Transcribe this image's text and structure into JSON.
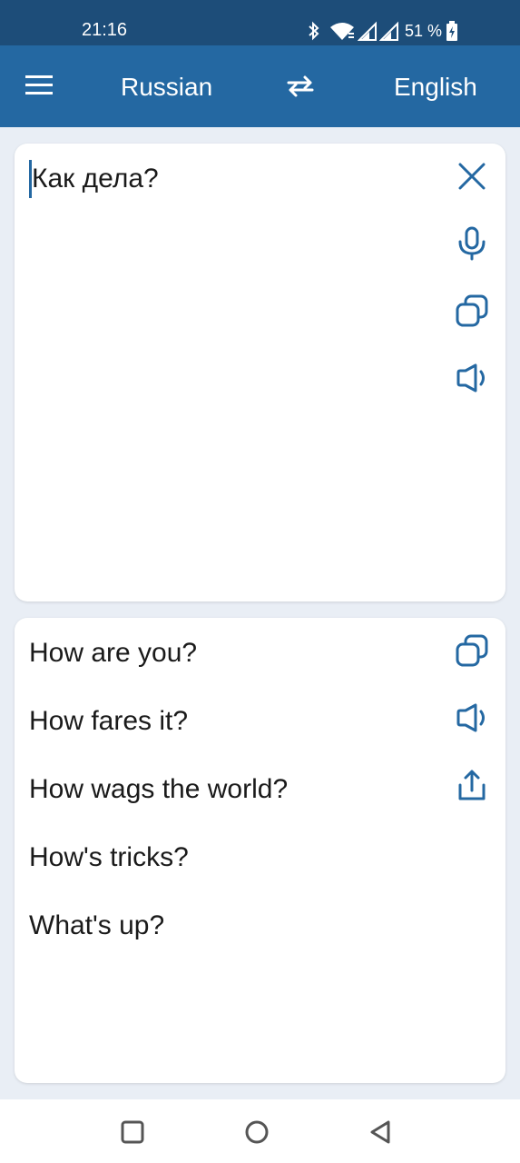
{
  "status": {
    "time": "21:16",
    "battery": "51 %",
    "icons": [
      "bluetooth-icon",
      "wifi-icon",
      "signal-icon",
      "signal-icon",
      "battery-charging-icon"
    ]
  },
  "toolbar": {
    "source_language": "Russian",
    "target_language": "English",
    "menu_icon": "menu-icon",
    "swap_icon": "swap-arrows-icon"
  },
  "input": {
    "text": "Как дела?",
    "actions": [
      "close-icon",
      "microphone-icon",
      "copy-icon",
      "speaker-icon"
    ]
  },
  "output": {
    "results": [
      "How are you?",
      "How fares it?",
      "How wags the world?",
      "How's tricks?",
      "What's up?"
    ],
    "actions": [
      "copy-icon",
      "speaker-icon",
      "share-icon"
    ]
  },
  "navigation": {
    "buttons": [
      "recents-icon",
      "home-icon",
      "back-icon"
    ]
  },
  "colors": {
    "status_bar": "#1d4d79",
    "app_bar": "#2468a2",
    "icon_accent": "#2468a2",
    "background": "#e9eef5"
  }
}
